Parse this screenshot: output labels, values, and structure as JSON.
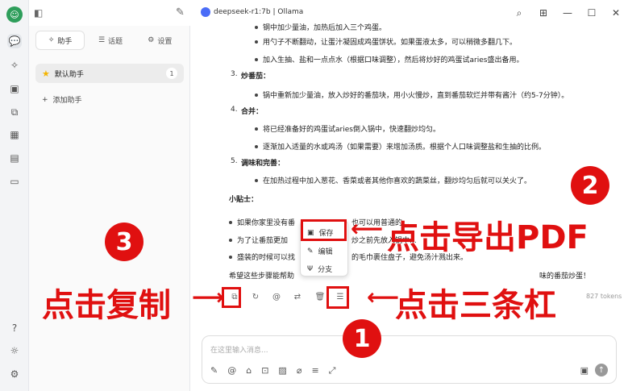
{
  "titlebar": {
    "title": "deepseek-r1:7b | Ollama"
  },
  "sidebar": {
    "tabs": [
      {
        "label": "助手",
        "icon": "sparkle-icon"
      },
      {
        "label": "话题",
        "icon": "list-icon"
      },
      {
        "label": "设置",
        "icon": "gear-icon"
      }
    ],
    "assistant": {
      "name": "默认助手",
      "count": "1"
    },
    "add_label": "添加助手"
  },
  "content": {
    "lines": [
      "钢中加少量油，加热后加入三个鸡蛋。",
      "用勺子不断翻动，让蛋汁凝固成鸡蛋饼状。如果蛋液太多，可以稍微多翻几下。",
      "加入生抽、盐和一点点水（根据口味调整），然后将炒好的鸡蛋试aries盛出备用。"
    ],
    "step3_title": "炒番茄：",
    "step3_line": "锅中重新加少量油，放入炒好的番茄块，用小火慢炒，直到番茄软烂并带有酱汁（约5-7分钟）。",
    "step4_title": "合并：",
    "step4_lines": [
      "将已经准备好的鸡蛋试aries倒入锅中，快速翻炒均匀。",
      "逐渐加入适量的水或鸡汤（如果需要）来增加汤质。根据个人口味调整盐和生抽的比例。"
    ],
    "step5_title": "调味和完善：",
    "step5_line": "在加热过程中加入葱花、香菜或者其他你喜欢的蔬菜丝，翻炒均匀后就可以关火了。",
    "tips_title": "小贴士：",
    "tips": [
      "如果你家里没有番",
      "也可以用普通的...",
      "为了让番茄更加",
      "炒之前先放入锅中...",
      "盛装的时候可以找",
      "的毛巾裹住盘子，避免汤汁溅出来。"
    ],
    "closing_left": "希望这些步骤能帮助",
    "closing_right": "味的番茄炒蛋！",
    "meta": "827 tokens"
  },
  "menu": {
    "items": [
      "保存",
      "编辑",
      "分支"
    ]
  },
  "input": {
    "placeholder": "在这里输入消息..."
  },
  "annotations": {
    "export_label": "点击导出PDF",
    "copy_label": "点击复制",
    "menu_label": "点击三条杠",
    "num1": "1",
    "num2": "2",
    "num3": "3"
  },
  "colors": {
    "accent": "#e01010",
    "avatar": "#2e9e5b"
  }
}
